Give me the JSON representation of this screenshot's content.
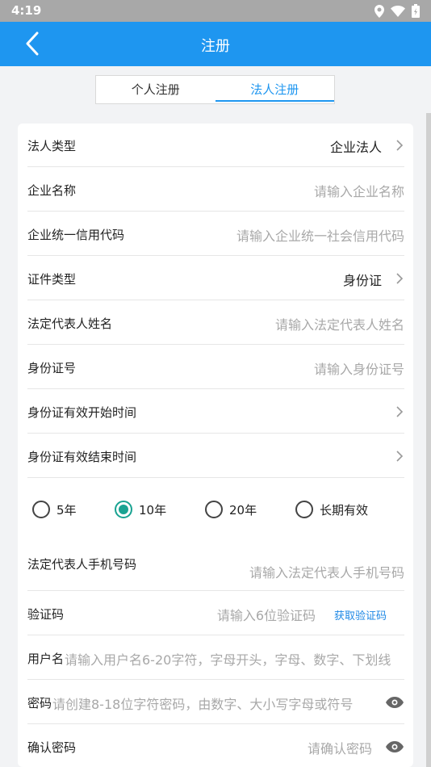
{
  "status_bar": {
    "time": "4:19",
    "icons": [
      "location-icon",
      "wifi-icon",
      "battery-icon"
    ]
  },
  "app_bar": {
    "title": "注册",
    "back_icon": "chevron-left-icon"
  },
  "tabs": [
    {
      "label": "个人注册",
      "active": false
    },
    {
      "label": "法人注册",
      "active": true
    }
  ],
  "form": {
    "legal_type": {
      "label": "法人类型",
      "value": "企业法人"
    },
    "company_name": {
      "label": "企业名称",
      "placeholder": "请输入企业名称"
    },
    "credit_code": {
      "label": "企业统一信用代码",
      "placeholder": "请输入企业统一社会信用代码"
    },
    "id_type": {
      "label": "证件类型",
      "value": "身份证"
    },
    "rep_name": {
      "label": "法定代表人姓名",
      "placeholder": "请输入法定代表人姓名"
    },
    "id_number": {
      "label": "身份证号",
      "placeholder": "请输入身份证号"
    },
    "id_start": {
      "label": "身份证有效开始时间"
    },
    "id_end": {
      "label": "身份证有效结束时间"
    },
    "validity_options": [
      {
        "label": "5年",
        "checked": false
      },
      {
        "label": "10年",
        "checked": true
      },
      {
        "label": "20年",
        "checked": false
      },
      {
        "label": "长期有效",
        "checked": false
      }
    ],
    "rep_phone": {
      "label": "法定代表人手机号码",
      "placeholder": "请输入法定代表人手机号码"
    },
    "verify_code": {
      "label": "验证码",
      "placeholder": "请输入6位验证码",
      "action": "获取验证码"
    },
    "username": {
      "label": "用户名",
      "placeholder": "请输入用户名6-20字符，字母开头，字母、数字、下划线"
    },
    "password": {
      "label": "密码",
      "placeholder": "请创建8-18位字符密码，由数字、大小写字母或符号"
    },
    "confirm_password": {
      "label": "确认密码",
      "placeholder": "请确认密码"
    }
  },
  "colors": {
    "primary": "#1e96f0",
    "radio_checked": "#1aa392",
    "link": "#1e88e5"
  }
}
